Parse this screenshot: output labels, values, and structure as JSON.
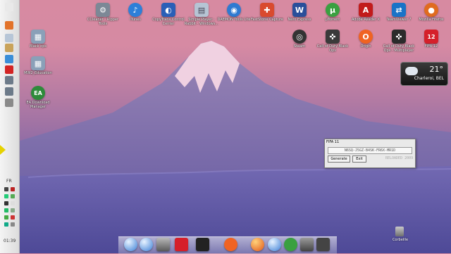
{
  "desktop_icons": [
    {
      "id": "cpuid",
      "label": "CCleaner - Ripper Tools",
      "color": "#7c8896",
      "glyph": "⚙"
    },
    {
      "id": "itunes",
      "label": "iTunes",
      "color": "#2d7fd8",
      "glyph": "♪"
    },
    {
      "id": "control",
      "label": "CopyTrans Control Center",
      "color": "#2a5fb7",
      "glyph": "◐"
    },
    {
      "id": "player",
      "label": "Simple Player - Rabbit - Windows...",
      "color": "#b6c4d4",
      "glyph": "▤"
    },
    {
      "id": "daemon",
      "label": "DAEMON Tools Lite",
      "color": "#2f7ad1",
      "glyph": "◉"
    },
    {
      "id": "fastone",
      "label": "FastStone Capture",
      "color": "#d94a2e",
      "glyph": "✚"
    },
    {
      "id": "word",
      "label": "Nero Express",
      "color": "#2a4f9a",
      "glyph": "W"
    },
    {
      "id": "utorrent",
      "label": "µTorrent",
      "color": "#3aa040",
      "glyph": "µ"
    },
    {
      "id": "acrobat",
      "label": "Adobe Reader X",
      "color": "#c21b1b",
      "glyph": "A"
    },
    {
      "id": "teamviewer",
      "label": "TeamViewer 7",
      "color": "#1a73c7",
      "glyph": "⇄"
    },
    {
      "id": "firefox",
      "label": "Mozilla Firefox",
      "color": "#e06b1f",
      "glyph": "●"
    },
    {
      "id": "steam",
      "label": "Steam",
      "color": "#333333",
      "glyph": "◎"
    },
    {
      "id": "cod1",
      "label": "Call of Duty Black Ops",
      "color": "#3a3a3a",
      "glyph": "✜"
    },
    {
      "id": "origin",
      "label": "Origin",
      "color": "#f06322",
      "glyph": "O"
    },
    {
      "id": "cod2",
      "label": "Call of Duty Black Ops - Multiplayer",
      "color": "#2b2b2b",
      "glyph": "✜"
    },
    {
      "id": "fifa12",
      "label": "FIFA 12",
      "color": "#d51f2a",
      "glyph": "12"
    },
    {
      "id": "ea",
      "label": "EA Download Manager",
      "color": "#2e8b3a",
      "glyph": "EA"
    },
    {
      "id": "blackops",
      "label": "Black ops",
      "color": "#8aa0b8",
      "glyph": "▦"
    },
    {
      "id": "mw2",
      "label": "MW2_Education",
      "color": "#8aa0b8",
      "glyph": "▦"
    }
  ],
  "weather": {
    "temp": "21°",
    "location": "Charleroi, BEL"
  },
  "keygen": {
    "title": "FIFA 11",
    "serial": "N6SQ-J5GZ-B4SK-FR6X-MR1D",
    "generate_label": "Generate",
    "exit_label": "Exit",
    "credit": "RELOADED 2009"
  },
  "side_dock": {
    "lang": "FR",
    "time": "01:39"
  },
  "trash": {
    "label": "Corbeille"
  },
  "colors": {
    "keygen_bg": "#e9e9e9",
    "mountain": "#7d6ea4",
    "snow": "#f3d7e4"
  }
}
